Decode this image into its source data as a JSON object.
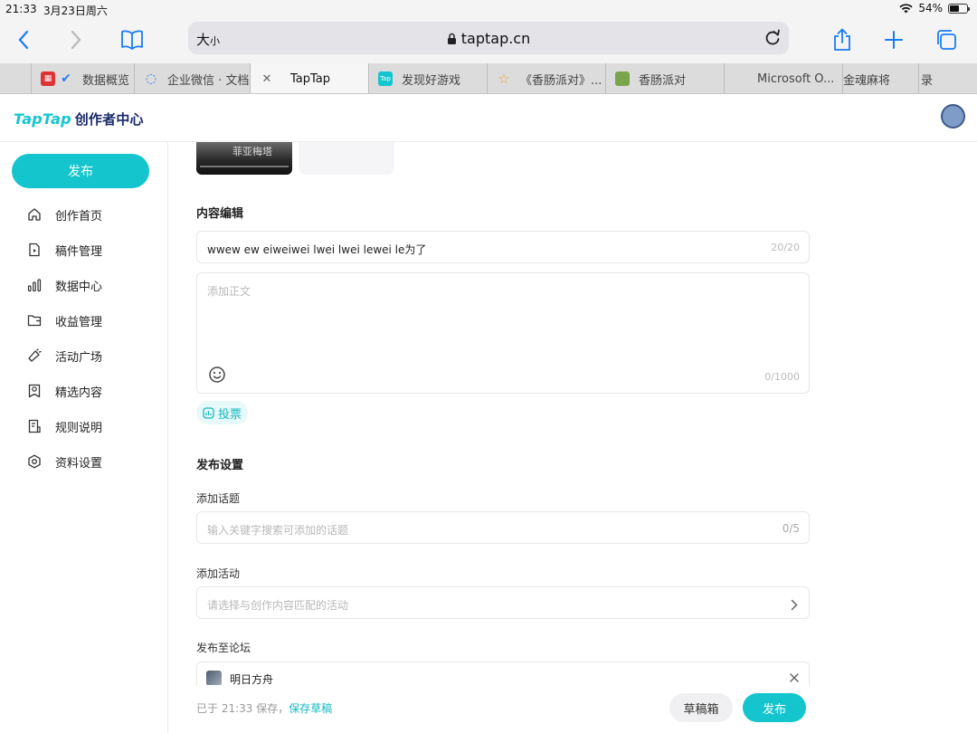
{
  "status_bar": {
    "time": "21:33",
    "date": "3月23日周六",
    "battery": "54%",
    "battery_level": 0.54
  },
  "browser": {
    "reader_size_label": "大",
    "reader_size_small": "小",
    "url": "taptap.cn",
    "icons": [
      "back-icon",
      "forward-icon",
      "bookmarks-icon",
      "lock-icon",
      "reload-icon",
      "share-icon",
      "new-tab-icon",
      "tabs-overview-icon"
    ]
  },
  "tabs": [
    {
      "label": "数据概览",
      "active": false
    },
    {
      "label": "企业微信 · 文档",
      "active": false
    },
    {
      "label": "TapTap",
      "active": true
    },
    {
      "label": "发现好游戏",
      "active": false
    },
    {
      "label": "《香肠派对》...",
      "active": false
    },
    {
      "label": "香肠派对",
      "active": false
    },
    {
      "label": "Microsoft O...",
      "active": false
    },
    {
      "label": "金魂麻将",
      "active": false
    },
    {
      "label": "录",
      "active": false
    }
  ],
  "header": {
    "logo_main": "TapTap",
    "logo_sub": "创作者中心"
  },
  "sidebar": {
    "publish_label": "发布",
    "items": [
      {
        "label": "创作首页",
        "icon": "home-icon"
      },
      {
        "label": "稿件管理",
        "icon": "file-icon"
      },
      {
        "label": "数据中心",
        "icon": "bar-chart-icon"
      },
      {
        "label": "收益管理",
        "icon": "wallet-icon"
      },
      {
        "label": "活动广场",
        "icon": "megaphone-icon"
      },
      {
        "label": "精选内容",
        "icon": "badge-icon"
      },
      {
        "label": "规则说明",
        "icon": "rules-doc-icon"
      },
      {
        "label": "资料设置",
        "icon": "settings-icon"
      }
    ]
  },
  "editor": {
    "thumb_caption": "菲亚梅塔",
    "content_section_title": "内容编辑",
    "title_value": "wwew ew eiweiwei lwei lwei lewei le为了",
    "title_count": "20/20",
    "body_placeholder": "添加正文",
    "body_count": "0/1000",
    "vote_label": "投票"
  },
  "publish_settings": {
    "section_title": "发布设置",
    "topic_label": "添加话题",
    "topic_placeholder": "输入关键字搜索可添加的话题",
    "topic_count": "0/5",
    "activity_label": "添加活动",
    "activity_placeholder": "请选择与创作内容匹配的活动",
    "forum_label": "发布至论坛",
    "forum_selected": "明日方舟"
  },
  "footer": {
    "saved_text": "已于 21:33 保存，",
    "save_draft_label": "保存草稿",
    "drafts_button": "草稿箱",
    "publish_button": "发布"
  },
  "colors": {
    "accent": "#15c5ce",
    "logo_sub": "#1a2a6a",
    "safari_blue": "#1a7cf5"
  }
}
